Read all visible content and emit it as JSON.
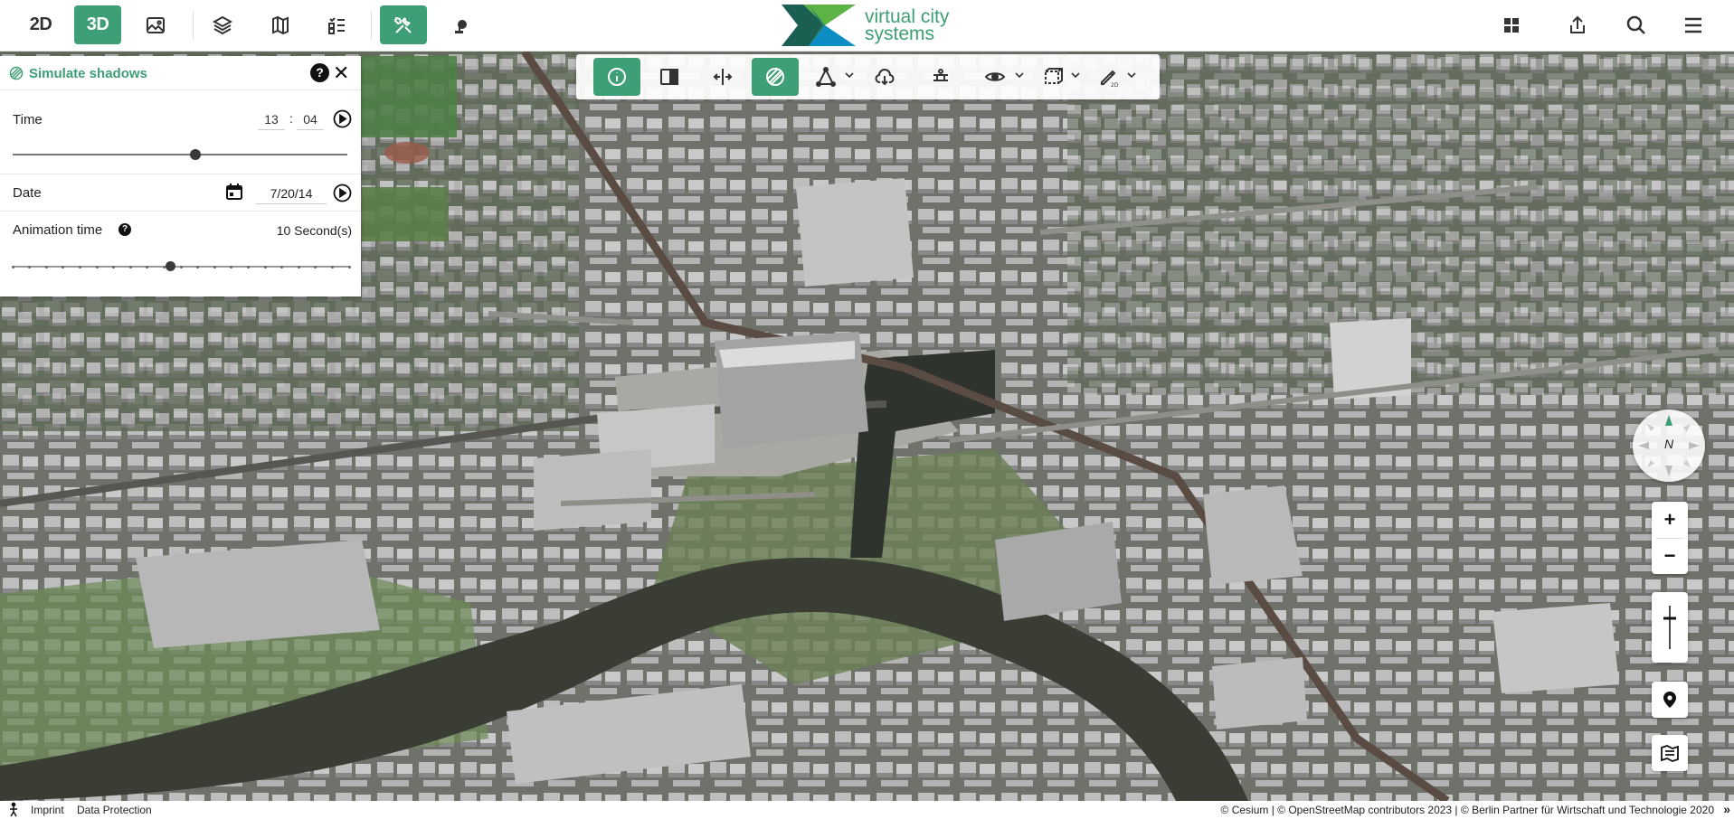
{
  "nav": {
    "btn_2d": "2D",
    "btn_3d": "3D",
    "icons": [
      "image-icon",
      "layers-icon",
      "legend-icon",
      "content-tree-icon",
      "tools-icon",
      "toolbox-icon"
    ],
    "right_icons": [
      "dashboard-icon",
      "share-icon",
      "search-icon",
      "menu-icon"
    ]
  },
  "logo": {
    "line1": "virtual city",
    "line2": "systems"
  },
  "toolbar": {
    "buttons": [
      "info-icon",
      "split-view-icon",
      "compare-icon",
      "shadow-icon",
      "measure-icon",
      "export-icon",
      "flight-icon",
      "viewshed-icon",
      "clipping-icon",
      "draw-2d-icon"
    ],
    "active": [
      "info",
      "shadow"
    ]
  },
  "panel": {
    "title": "Simulate shadows",
    "time_label": "Time",
    "hour": "13",
    "minute": "04",
    "time_separator": ":",
    "time_slider_fraction": 0.545,
    "date_label": "Date",
    "date_value": "7/20/14",
    "animation_label": "Animation time",
    "animation_value": "10 Second(s)",
    "animation_slider_fraction": 0.47
  },
  "compass": {
    "north": "N"
  },
  "zoom": {
    "in": "+",
    "out": "−"
  },
  "footer": {
    "imprint": "Imprint",
    "data_protection": "Data Protection",
    "attribution": "© Cesium  | © OpenStreetMap contributors 2023 | © Berlin Partner für Wirtschaft und Technologie 2020",
    "more": "»"
  },
  "colors": {
    "accent": "#3e9e76",
    "accent_dark": "#1b5e52",
    "logo_blue": "#0c8ec4"
  }
}
